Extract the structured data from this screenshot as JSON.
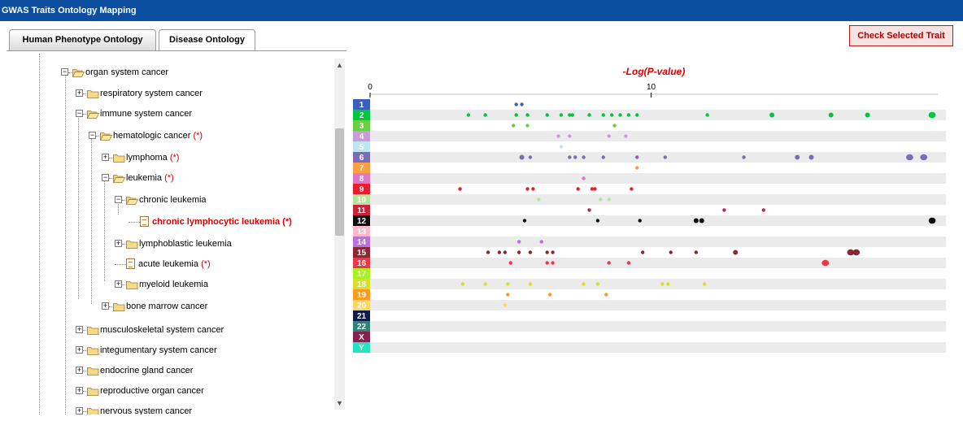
{
  "app": {
    "title": "GWAS Traits Ontology Mapping"
  },
  "tabs": [
    {
      "label": "Human Phenotype Ontology",
      "active": false
    },
    {
      "label": "Disease Ontology",
      "active": true
    }
  ],
  "toolbar": {
    "check_label": "Check Selected Trait"
  },
  "tree": {
    "nodes": [
      {
        "label": "organ system cancer",
        "ast": "",
        "expanded": true,
        "leaf": false
      },
      {
        "label": "respiratory system cancer",
        "ast": "",
        "expanded": false,
        "leaf": false
      },
      {
        "label": "immune system cancer",
        "ast": "",
        "expanded": true,
        "leaf": false
      },
      {
        "label": "hematologic cancer",
        "ast": "(*)",
        "expanded": true,
        "leaf": false
      },
      {
        "label": "lymphoma",
        "ast": "(*)",
        "expanded": false,
        "leaf": false
      },
      {
        "label": "leukemia",
        "ast": "(*)",
        "expanded": true,
        "leaf": false
      },
      {
        "label": "chronic leukemia",
        "ast": "",
        "expanded": true,
        "leaf": false
      },
      {
        "label": "chronic lymphocytic leukemia (*)",
        "ast": "",
        "expanded": false,
        "leaf": true,
        "selected": true
      },
      {
        "label": "lymphoblastic leukemia",
        "ast": "",
        "expanded": false,
        "leaf": false
      },
      {
        "label": "acute leukemia",
        "ast": "(*)",
        "expanded": false,
        "leaf": true
      },
      {
        "label": "myeloid leukemia",
        "ast": "",
        "expanded": false,
        "leaf": false
      },
      {
        "label": "bone marrow cancer",
        "ast": "",
        "expanded": false,
        "leaf": false
      },
      {
        "label": "musculoskeletal system cancer",
        "ast": "",
        "expanded": false,
        "leaf": false
      },
      {
        "label": "integumentary system cancer",
        "ast": "",
        "expanded": false,
        "leaf": false
      },
      {
        "label": "endocrine gland cancer",
        "ast": "",
        "expanded": false,
        "leaf": false
      },
      {
        "label": "reproductive organ cancer",
        "ast": "",
        "expanded": false,
        "leaf": false
      },
      {
        "label": "nervous system cancer",
        "ast": "",
        "expanded": false,
        "leaf": false
      }
    ]
  },
  "icons": {
    "toggle_expanded": "minus-icon",
    "toggle_collapsed": "plus-icon",
    "folder": "folder-icon",
    "document": "document-icon",
    "scroll_up": "up-arrow-icon",
    "scroll_down": "down-arrow-icon"
  },
  "colors": {
    "titlebar": "#0c4fa1",
    "accent_red": "#dd0000",
    "row_stripe": "#ebebeb"
  },
  "chart_data": {
    "type": "scatter",
    "title": "-Log(P-value)",
    "xlabel": "",
    "ylabel": "",
    "xlim": [
      0,
      20.2
    ],
    "xticks": [
      0,
      10
    ],
    "grid": "alternating row stripes",
    "categories": [
      "1",
      "2",
      "3",
      "4",
      "5",
      "6",
      "7",
      "8",
      "9",
      "10",
      "11",
      "12",
      "13",
      "14",
      "15",
      "16",
      "17",
      "18",
      "19",
      "20",
      "21",
      "22",
      "X",
      "Y"
    ],
    "category_colors": [
      "#3b5fbf",
      "#00c83c",
      "#69d040",
      "#c79dd8",
      "#bfe6f0",
      "#7d6bb8",
      "#ff9f3f",
      "#dd77c8",
      "#e81c2a",
      "#b6e39b",
      "#c9223b",
      "#0c0c0c",
      "#fbb8d0",
      "#bf6de2",
      "#8a2834",
      "#ef3648",
      "#aaf022",
      "#d6e02c",
      "#ff9b1c",
      "#f9d56a",
      "#101a4a",
      "#2b8476",
      "#86204d",
      "#23e3c0"
    ],
    "points": [
      {
        "chr": "1",
        "x": 5.2,
        "size": 1
      },
      {
        "chr": "1",
        "x": 5.4,
        "size": 1
      },
      {
        "chr": "2",
        "x": 3.5,
        "size": 1
      },
      {
        "chr": "2",
        "x": 4.1,
        "size": 1
      },
      {
        "chr": "2",
        "x": 5.2,
        "size": 1
      },
      {
        "chr": "2",
        "x": 5.6,
        "size": 1
      },
      {
        "chr": "2",
        "x": 6.3,
        "size": 1
      },
      {
        "chr": "2",
        "x": 6.8,
        "size": 1
      },
      {
        "chr": "2",
        "x": 7.1,
        "size": 1
      },
      {
        "chr": "2",
        "x": 7.2,
        "size": 1
      },
      {
        "chr": "2",
        "x": 7.8,
        "size": 1
      },
      {
        "chr": "2",
        "x": 8.3,
        "size": 1
      },
      {
        "chr": "2",
        "x": 8.6,
        "size": 1
      },
      {
        "chr": "2",
        "x": 8.9,
        "size": 1
      },
      {
        "chr": "2",
        "x": 9.2,
        "size": 1
      },
      {
        "chr": "2",
        "x": 9.5,
        "size": 1
      },
      {
        "chr": "2",
        "x": 12.0,
        "size": 1
      },
      {
        "chr": "2",
        "x": 14.3,
        "size": 2
      },
      {
        "chr": "2",
        "x": 16.4,
        "size": 2
      },
      {
        "chr": "2",
        "x": 17.7,
        "size": 2
      },
      {
        "chr": "2",
        "x": 20.0,
        "size": 3
      },
      {
        "chr": "3",
        "x": 5.1,
        "size": 1
      },
      {
        "chr": "3",
        "x": 5.6,
        "size": 1
      },
      {
        "chr": "3",
        "x": 8.7,
        "size": 1
      },
      {
        "chr": "4",
        "x": 6.7,
        "size": 1
      },
      {
        "chr": "4",
        "x": 7.1,
        "size": 1
      },
      {
        "chr": "4",
        "x": 8.5,
        "size": 1
      },
      {
        "chr": "4",
        "x": 9.1,
        "size": 1
      },
      {
        "chr": "5",
        "x": 6.8,
        "size": 1
      },
      {
        "chr": "6",
        "x": 5.4,
        "size": 2
      },
      {
        "chr": "6",
        "x": 5.7,
        "size": 1
      },
      {
        "chr": "6",
        "x": 7.1,
        "size": 1
      },
      {
        "chr": "6",
        "x": 7.3,
        "size": 1
      },
      {
        "chr": "6",
        "x": 7.6,
        "size": 1
      },
      {
        "chr": "6",
        "x": 8.3,
        "size": 1
      },
      {
        "chr": "6",
        "x": 9.5,
        "size": 1
      },
      {
        "chr": "6",
        "x": 10.5,
        "size": 1
      },
      {
        "chr": "6",
        "x": 13.3,
        "size": 1
      },
      {
        "chr": "6",
        "x": 15.2,
        "size": 2
      },
      {
        "chr": "6",
        "x": 15.7,
        "size": 2
      },
      {
        "chr": "6",
        "x": 19.2,
        "size": 3
      },
      {
        "chr": "6",
        "x": 19.7,
        "size": 3
      },
      {
        "chr": "7",
        "x": 9.5,
        "size": 1
      },
      {
        "chr": "8",
        "x": 7.6,
        "size": 1
      },
      {
        "chr": "9",
        "x": 3.2,
        "size": 1
      },
      {
        "chr": "9",
        "x": 5.6,
        "size": 1
      },
      {
        "chr": "9",
        "x": 5.8,
        "size": 1
      },
      {
        "chr": "9",
        "x": 7.4,
        "size": 1
      },
      {
        "chr": "9",
        "x": 7.9,
        "size": 1
      },
      {
        "chr": "9",
        "x": 8.0,
        "size": 1
      },
      {
        "chr": "9",
        "x": 9.3,
        "size": 1
      },
      {
        "chr": "10",
        "x": 6.0,
        "size": 1
      },
      {
        "chr": "10",
        "x": 8.2,
        "size": 1
      },
      {
        "chr": "10",
        "x": 8.5,
        "size": 1
      },
      {
        "chr": "11",
        "x": 7.8,
        "size": 1
      },
      {
        "chr": "11",
        "x": 12.6,
        "size": 1
      },
      {
        "chr": "11",
        "x": 14.0,
        "size": 1
      },
      {
        "chr": "12",
        "x": 5.5,
        "size": 1
      },
      {
        "chr": "12",
        "x": 8.1,
        "size": 1
      },
      {
        "chr": "12",
        "x": 9.6,
        "size": 1
      },
      {
        "chr": "12",
        "x": 11.6,
        "size": 2
      },
      {
        "chr": "12",
        "x": 11.8,
        "size": 2
      },
      {
        "chr": "12",
        "x": 20.0,
        "size": 3
      },
      {
        "chr": "14",
        "x": 5.3,
        "size": 1
      },
      {
        "chr": "14",
        "x": 6.1,
        "size": 1
      },
      {
        "chr": "15",
        "x": 4.2,
        "size": 1
      },
      {
        "chr": "15",
        "x": 4.6,
        "size": 1
      },
      {
        "chr": "15",
        "x": 4.8,
        "size": 1
      },
      {
        "chr": "15",
        "x": 5.3,
        "size": 1
      },
      {
        "chr": "15",
        "x": 5.7,
        "size": 1
      },
      {
        "chr": "15",
        "x": 6.3,
        "size": 1
      },
      {
        "chr": "15",
        "x": 6.5,
        "size": 1
      },
      {
        "chr": "15",
        "x": 9.7,
        "size": 1
      },
      {
        "chr": "15",
        "x": 10.7,
        "size": 1
      },
      {
        "chr": "15",
        "x": 11.6,
        "size": 1
      },
      {
        "chr": "15",
        "x": 13.0,
        "size": 2
      },
      {
        "chr": "15",
        "x": 17.1,
        "size": 3
      },
      {
        "chr": "15",
        "x": 17.3,
        "size": 3
      },
      {
        "chr": "16",
        "x": 5.0,
        "size": 1
      },
      {
        "chr": "16",
        "x": 6.3,
        "size": 1
      },
      {
        "chr": "16",
        "x": 6.5,
        "size": 1
      },
      {
        "chr": "16",
        "x": 8.5,
        "size": 1
      },
      {
        "chr": "16",
        "x": 9.2,
        "size": 1
      },
      {
        "chr": "16",
        "x": 16.2,
        "size": 3
      },
      {
        "chr": "18",
        "x": 3.3,
        "size": 1
      },
      {
        "chr": "18",
        "x": 4.1,
        "size": 1
      },
      {
        "chr": "18",
        "x": 4.9,
        "size": 1
      },
      {
        "chr": "18",
        "x": 5.7,
        "size": 1
      },
      {
        "chr": "18",
        "x": 7.6,
        "size": 1
      },
      {
        "chr": "18",
        "x": 8.1,
        "size": 1
      },
      {
        "chr": "18",
        "x": 10.4,
        "size": 1
      },
      {
        "chr": "18",
        "x": 10.6,
        "size": 1
      },
      {
        "chr": "18",
        "x": 11.9,
        "size": 1
      },
      {
        "chr": "19",
        "x": 4.9,
        "size": 1
      },
      {
        "chr": "19",
        "x": 6.4,
        "size": 1
      },
      {
        "chr": "19",
        "x": 8.4,
        "size": 1
      },
      {
        "chr": "20",
        "x": 4.8,
        "size": 1
      }
    ]
  }
}
